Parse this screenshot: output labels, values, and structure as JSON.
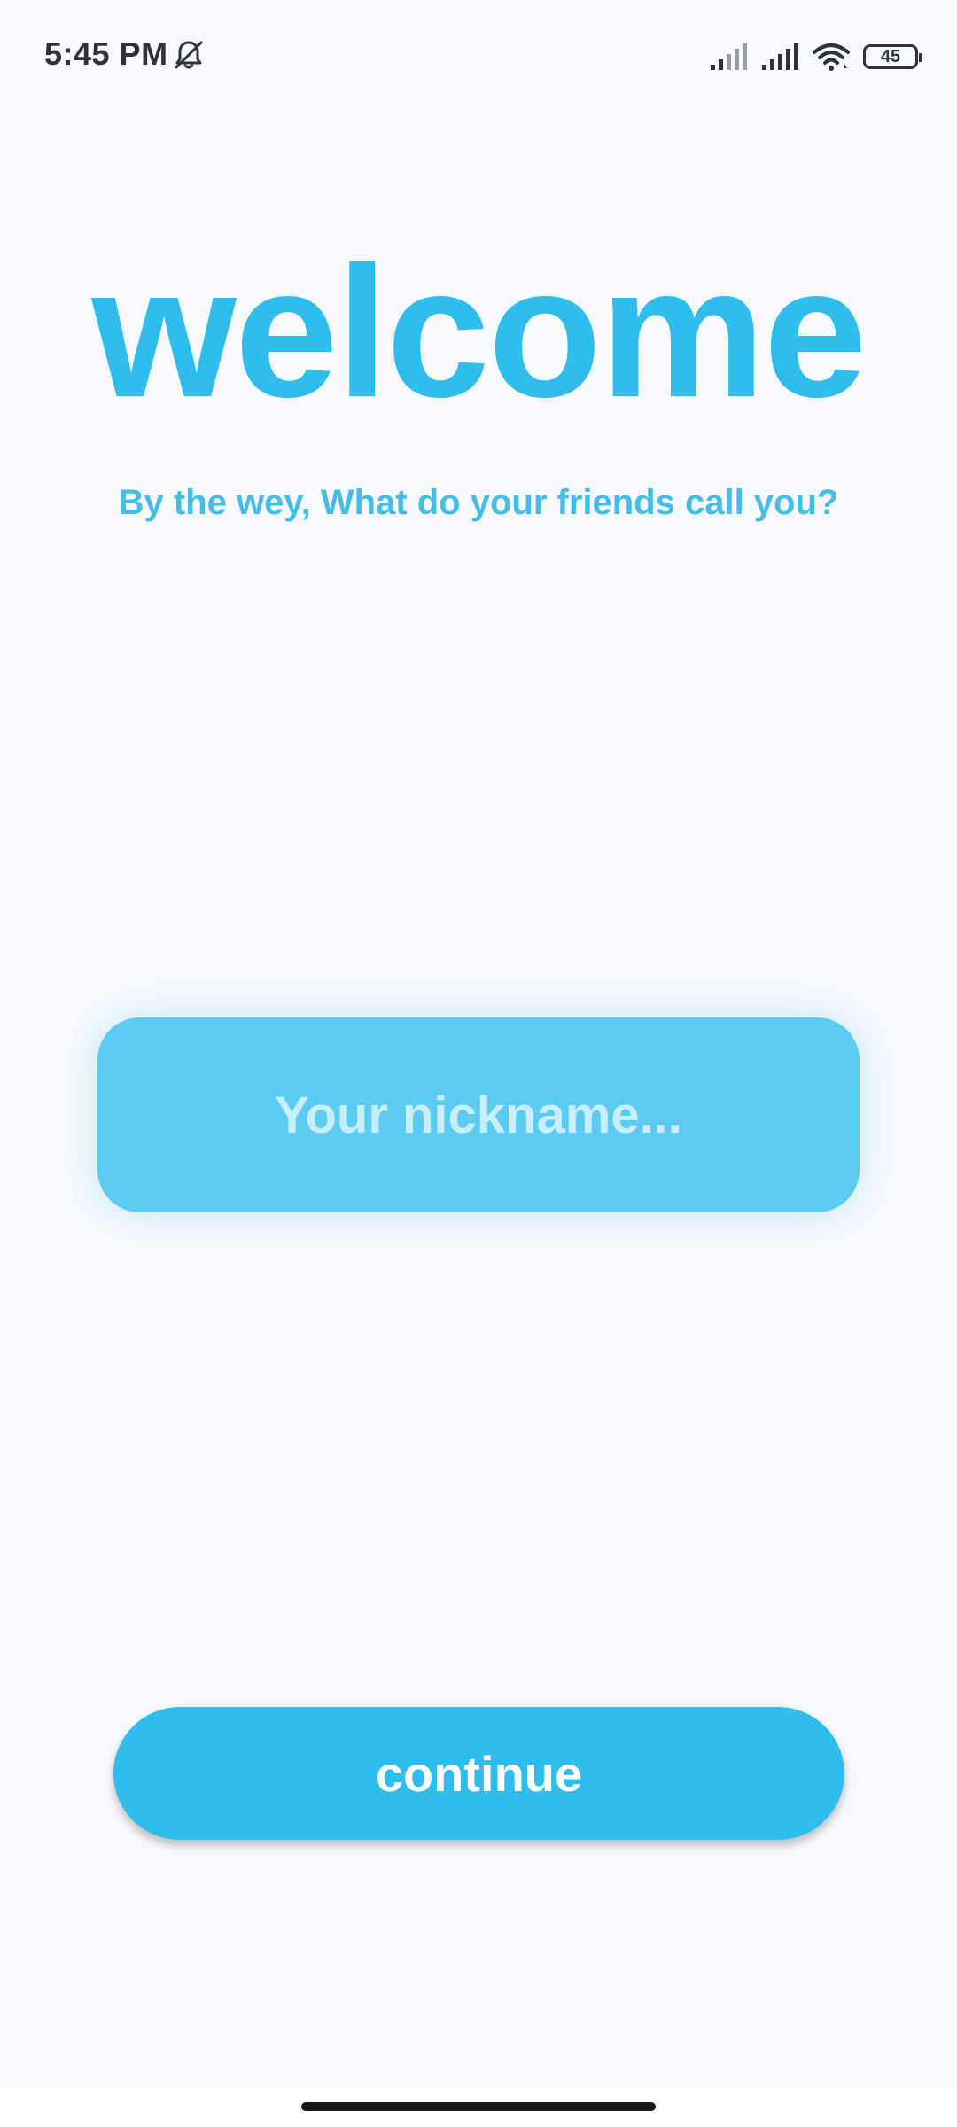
{
  "status_bar": {
    "time": "5:45 PM",
    "battery_level": "45",
    "icons": [
      "bell-muted-icon",
      "signal-icon",
      "signal-icon",
      "wifi-icon",
      "battery-icon"
    ]
  },
  "welcome": {
    "title": "welcome",
    "subtitle": "By the wey, What do your friends call you?"
  },
  "nickname": {
    "placeholder": "Your nickname...",
    "value": ""
  },
  "actions": {
    "continue_label": "continue"
  },
  "colors": {
    "background": "#f7f9fd",
    "accent": "#2ebdec",
    "input_fill": "#5ccbf1",
    "subtitle": "#44bde7"
  }
}
